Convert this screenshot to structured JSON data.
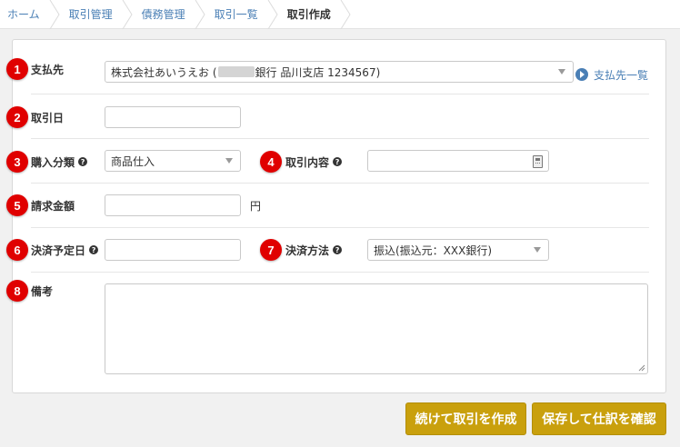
{
  "breadcrumb": [
    {
      "label": "ホーム"
    },
    {
      "label": "取引管理"
    },
    {
      "label": "債務管理"
    },
    {
      "label": "取引一覧"
    },
    {
      "label": "取引作成"
    }
  ],
  "form": {
    "payee": {
      "badge": "1",
      "label": "支払先",
      "value_prefix": "株式会社あいうえお (",
      "value_suffix": "銀行 品川支店 1234567)",
      "link": "支払先一覧"
    },
    "transaction_date": {
      "badge": "2",
      "label": "取引日",
      "value": ""
    },
    "purchase_category": {
      "badge": "3",
      "label": "購入分類",
      "value": "商品仕入"
    },
    "transaction_content": {
      "badge": "4",
      "label": "取引内容",
      "value": ""
    },
    "billing_amount": {
      "badge": "5",
      "label": "請求金額",
      "value": "",
      "unit": "円"
    },
    "settlement_date": {
      "badge": "6",
      "label": "決済予定日",
      "value": ""
    },
    "settlement_method": {
      "badge": "7",
      "label": "決済方法",
      "value": "振込(振込元：XXX銀行)"
    },
    "notes": {
      "badge": "8",
      "label": "備考",
      "value": ""
    }
  },
  "buttons": {
    "continue": "続けて取引を作成",
    "save": "保存して仕訳を確認"
  },
  "colors": {
    "badge": "#e00000",
    "button": "#c9a00d",
    "link": "#4a7fb5"
  }
}
